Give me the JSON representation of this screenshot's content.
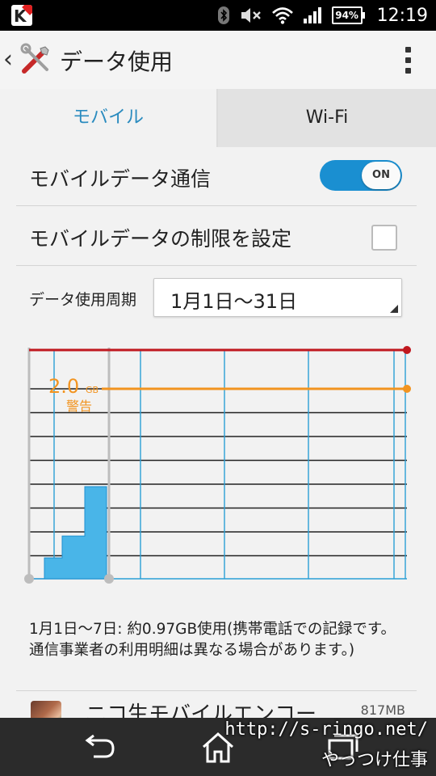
{
  "status_bar": {
    "battery": "94%",
    "time": "12:19"
  },
  "action_bar": {
    "title": "データ使用"
  },
  "tabs": [
    {
      "label": "モバイル",
      "selected": true
    },
    {
      "label": "Wi-Fi",
      "selected": false
    }
  ],
  "settings": {
    "mobile_data_label": "モバイルデータ通信",
    "mobile_data_toggle": "ON",
    "limit_label": "モバイルデータの制限を設定",
    "limit_checked": false,
    "cycle_label": "データ使用周期",
    "cycle_value": "1月1日〜31日"
  },
  "chart_data": {
    "type": "area",
    "warning_value": "2.0",
    "warning_unit": "GB",
    "warning_label": "警告",
    "usage_steps_gb": [
      0.0,
      0.22,
      0.45,
      0.97
    ],
    "colors": {
      "limit": "#c0181f",
      "warning": "#f29420",
      "usage": "#49b5e8",
      "grid": "#2a9fd6"
    }
  },
  "summary": "1月1日〜7日: 約0.97GB使用(携帯電話での記録です。通信事業者の利用明細は異なる場合があります。)",
  "app_list": [
    {
      "name": "ニコ生モバイルエンコー",
      "size": "817MB"
    }
  ],
  "watermark": {
    "line1": "http://s-ringo.net/",
    "line2": "やっつけ仕事"
  }
}
